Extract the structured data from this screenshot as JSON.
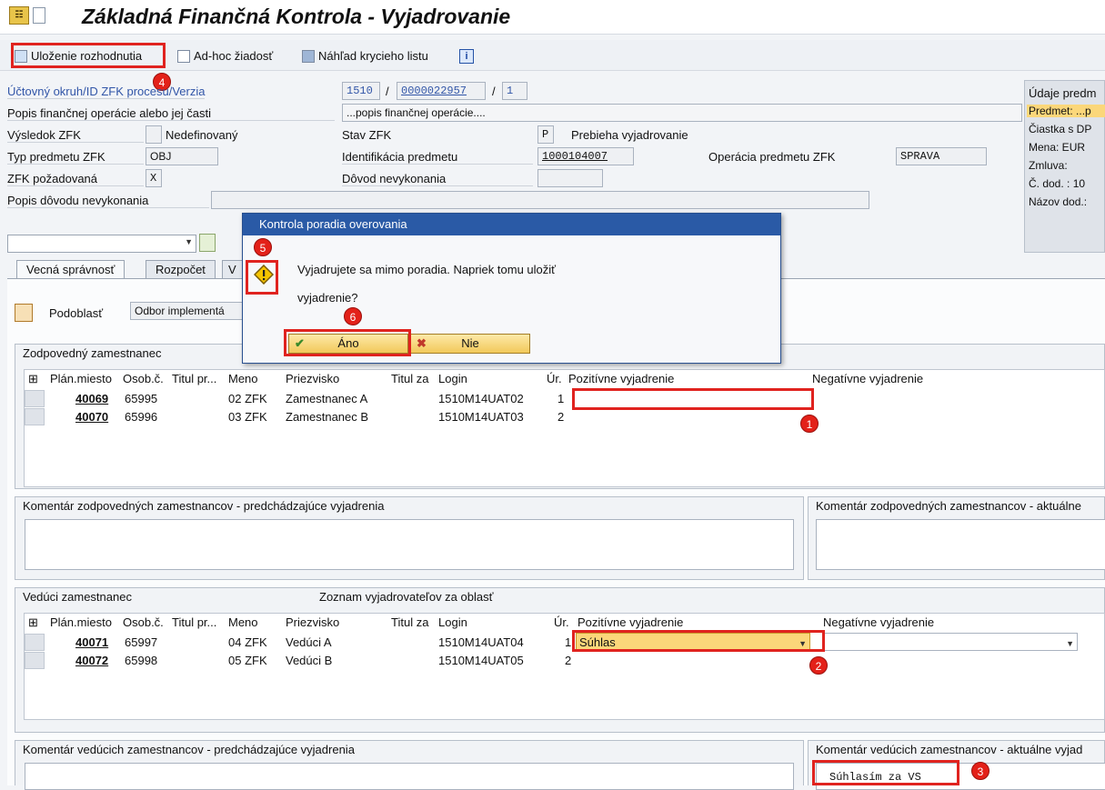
{
  "title": "Základná Finančná Kontrola - Vyjadrovanie",
  "toolbar": {
    "save": "Uloženie rozhodnutia",
    "adhoc": "Ad-hoc žiadosť",
    "preview": "Náhľad krycieho listu",
    "info_icon": "i"
  },
  "header": {
    "account_label": "Účtovný okruh/ID ZFK procesu/Verzia",
    "account_code": "1510",
    "sep1": "/",
    "process_id": "0000022957",
    "sep2": "/",
    "version": "1",
    "desc_label": "Popis finančnej operácie alebo jej časti",
    "desc_value": "...popis finančnej operácie....",
    "result_label": "Výsledok ZFK",
    "result_value": "Nedefinovaný",
    "state_label": "Stav ZFK",
    "state_code": "P",
    "state_value": "Prebieha vyjadrovanie",
    "type_label": "Typ predmetu ZFK",
    "type_value": "OBJ",
    "ident_label": "Identifikácia predmetu",
    "ident_value": "1000104007",
    "oper_label": "Operácia predmetu ZFK",
    "oper_value": "SPRAVA",
    "required_label": "ZFK požadovaná",
    "required_value": "X",
    "reason_label": "Dôvod nevykonania",
    "reason_desc_label": "Popis dôvodu nevykonania"
  },
  "right_panel": {
    "title": "Údaje predm",
    "subject": "Predmet: ...p",
    "amount": "Čiastka s DP",
    "currency": "Mena: EUR",
    "contract": "Zmluva:",
    "supplier_no": "Č. dod. : 10",
    "supplier_name": "Názov dod.:"
  },
  "tabs": [
    "Vecná správnosť",
    "Rozpočet",
    "V"
  ],
  "subarea": {
    "label": "Podoblasť",
    "value": "Odbor implementá"
  },
  "responsible": {
    "title": "Zodpovedný zamestnanec",
    "headers": [
      "Plán.miesto",
      "Osob.č.",
      "Titul pr...",
      "Meno",
      "Priezvisko",
      "Titul za",
      "Login",
      "Úr.",
      "Pozitívne vyjadrenie",
      "Negatívne vyjadrenie"
    ],
    "rows": [
      {
        "plan": "40069",
        "osob": "65995",
        "meno": "02 ZFK",
        "priezvisko": "Zamestnanec A",
        "login": "1510M14UAT02",
        "ur": "1"
      },
      {
        "plan": "40070",
        "osob": "65996",
        "meno": "03 ZFK",
        "priezvisko": "Zamestnanec B",
        "login": "1510M14UAT03",
        "ur": "2"
      }
    ]
  },
  "comments_resp": {
    "previous": "Komentár zodpovedných zamestnancov - predchádzajúce vyjadrenia",
    "current": "Komentár zodpovedných zamestnancov - aktuálne"
  },
  "managers": {
    "title": "Vedúci zamestnanec",
    "list_title": "Zoznam vyjadrovateľov za oblasť",
    "headers": [
      "Plán.miesto",
      "Osob.č.",
      "Titul pr...",
      "Meno",
      "Priezvisko",
      "Titul za",
      "Login",
      "Úr.",
      "Pozitívne vyjadrenie",
      "Negatívne vyjadrenie"
    ],
    "rows": [
      {
        "plan": "40071",
        "osob": "65997",
        "meno": "04 ZFK",
        "priezvisko": "Vedúci A",
        "login": "1510M14UAT04",
        "ur": "1",
        "positive": "Súhlas"
      },
      {
        "plan": "40072",
        "osob": "65998",
        "meno": "05 ZFK",
        "priezvisko": "Vedúci B",
        "login": "1510M14UAT05",
        "ur": "2",
        "positive": ""
      }
    ]
  },
  "comments_mgr": {
    "previous": "Komentár vedúcich zamestnancov - predchádzajúce vyjadrenia",
    "current": "Komentár vedúcich zamestnancov - aktuálne vyjad",
    "current_value": "Súhlasím za VS"
  },
  "dialog": {
    "title": "Kontrola poradia overovania",
    "line1": "Vyjadrujete sa mimo poradia. Napriek tomu uložiť",
    "line2": "vyjadrenie?",
    "yes": "Áno",
    "no": "Nie"
  },
  "badges": [
    "1",
    "2",
    "3",
    "4",
    "5",
    "6"
  ],
  "colors": {
    "accent": "#2a5aa6",
    "highlight": "#fbd77a",
    "annotation": "#e0231f"
  }
}
